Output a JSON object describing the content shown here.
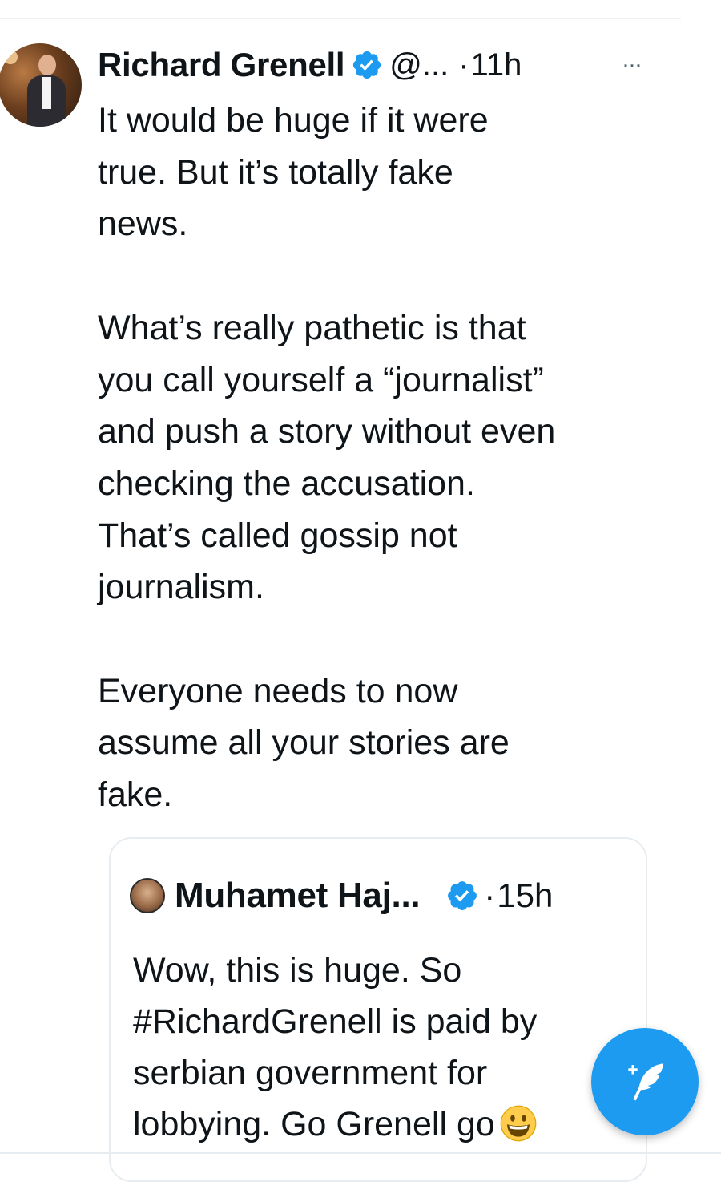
{
  "tweet": {
    "author_name": "Richard Grenell",
    "handle": "@...",
    "separator": "·",
    "time": "11h",
    "more_icon": "more-horizontal-icon",
    "text": "It would be huge if it were\ntrue. But it’s totally fake\nnews.\n\nWhat’s really pathetic is that\nyou call yourself a “journalist”\nand push a story without even\nchecking the accusation.\nThat’s called gossip not\njournalism.\n\nEveryone needs to now\nassume all your stories are\nfake."
  },
  "quote": {
    "author_name": "Muhamet Haj...",
    "separator": "·",
    "time": "15h",
    "text": "Wow, this is huge. So\n#RichardGrenell is paid by\nserbian government for\nlobbying. Go Grenell go",
    "emoji": "grinning-face-emoji"
  },
  "compose_button": {
    "icon": "compose-tweet-icon"
  },
  "colors": {
    "verified_blue": "#1d9bf0",
    "fab_blue": "#1d9bf0",
    "text": "#0f1419",
    "border": "#e6ecf0"
  }
}
